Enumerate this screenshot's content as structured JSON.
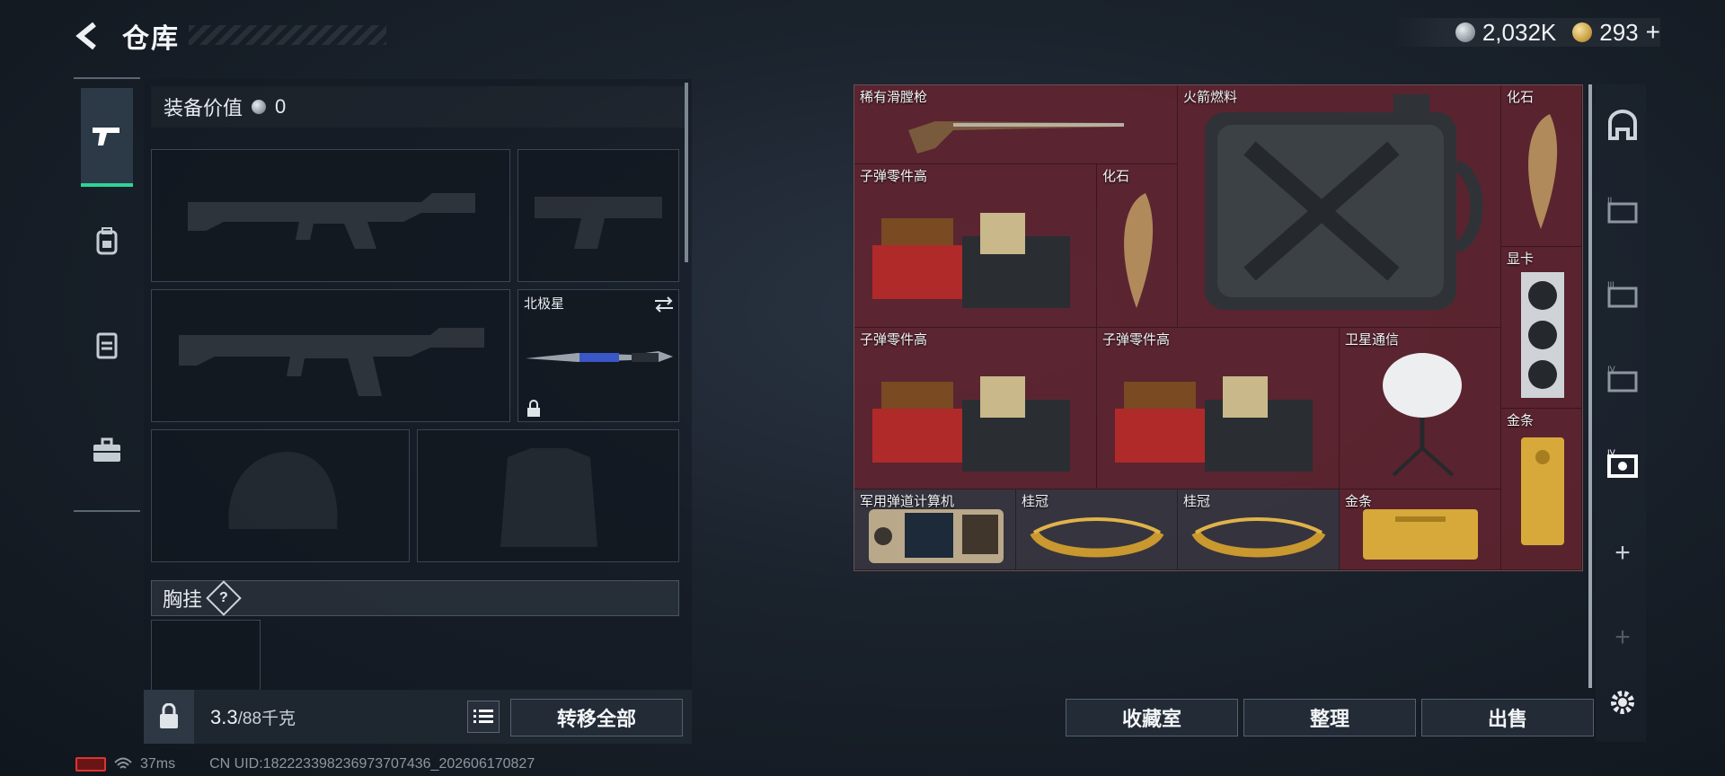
{
  "header": {
    "title": "仓库"
  },
  "currency": {
    "silver": "2,032K",
    "gold": "293"
  },
  "left_nav": {
    "items": [
      "weapons-icon",
      "backpack-icon",
      "vest-icon",
      "toolbox-icon"
    ]
  },
  "equipment": {
    "value_label": "装备价值",
    "value": "0",
    "slots": {
      "melee_name": "北极星"
    },
    "chest_label": "胸挂",
    "chest_help": "?"
  },
  "footer_left": {
    "weight_current": "3.3",
    "weight_max": "/88千克",
    "transfer_all": "转移全部"
  },
  "inventory": {
    "items": [
      {
        "name": "稀有滑膛枪"
      },
      {
        "name": "火箭燃料"
      },
      {
        "name": "化石"
      },
      {
        "name": "子弹零件高"
      },
      {
        "name": "化石"
      },
      {
        "name": "显卡"
      },
      {
        "name": "子弹零件高"
      },
      {
        "name": "子弹零件高"
      },
      {
        "name": "卫星通信"
      },
      {
        "name": "金条"
      },
      {
        "name": "军用弹道计算机"
      },
      {
        "name": "桂冠"
      },
      {
        "name": "桂冠"
      },
      {
        "name": "金条"
      }
    ]
  },
  "actions": {
    "collection": "收藏室",
    "organize": "整理",
    "sell": "出售"
  },
  "status": {
    "ping": "37ms",
    "uid": "CN UID:18222339823697370743​6_202606170827"
  },
  "colors": {
    "accent_green": "#2fd39a",
    "item_red": "#662632"
  }
}
